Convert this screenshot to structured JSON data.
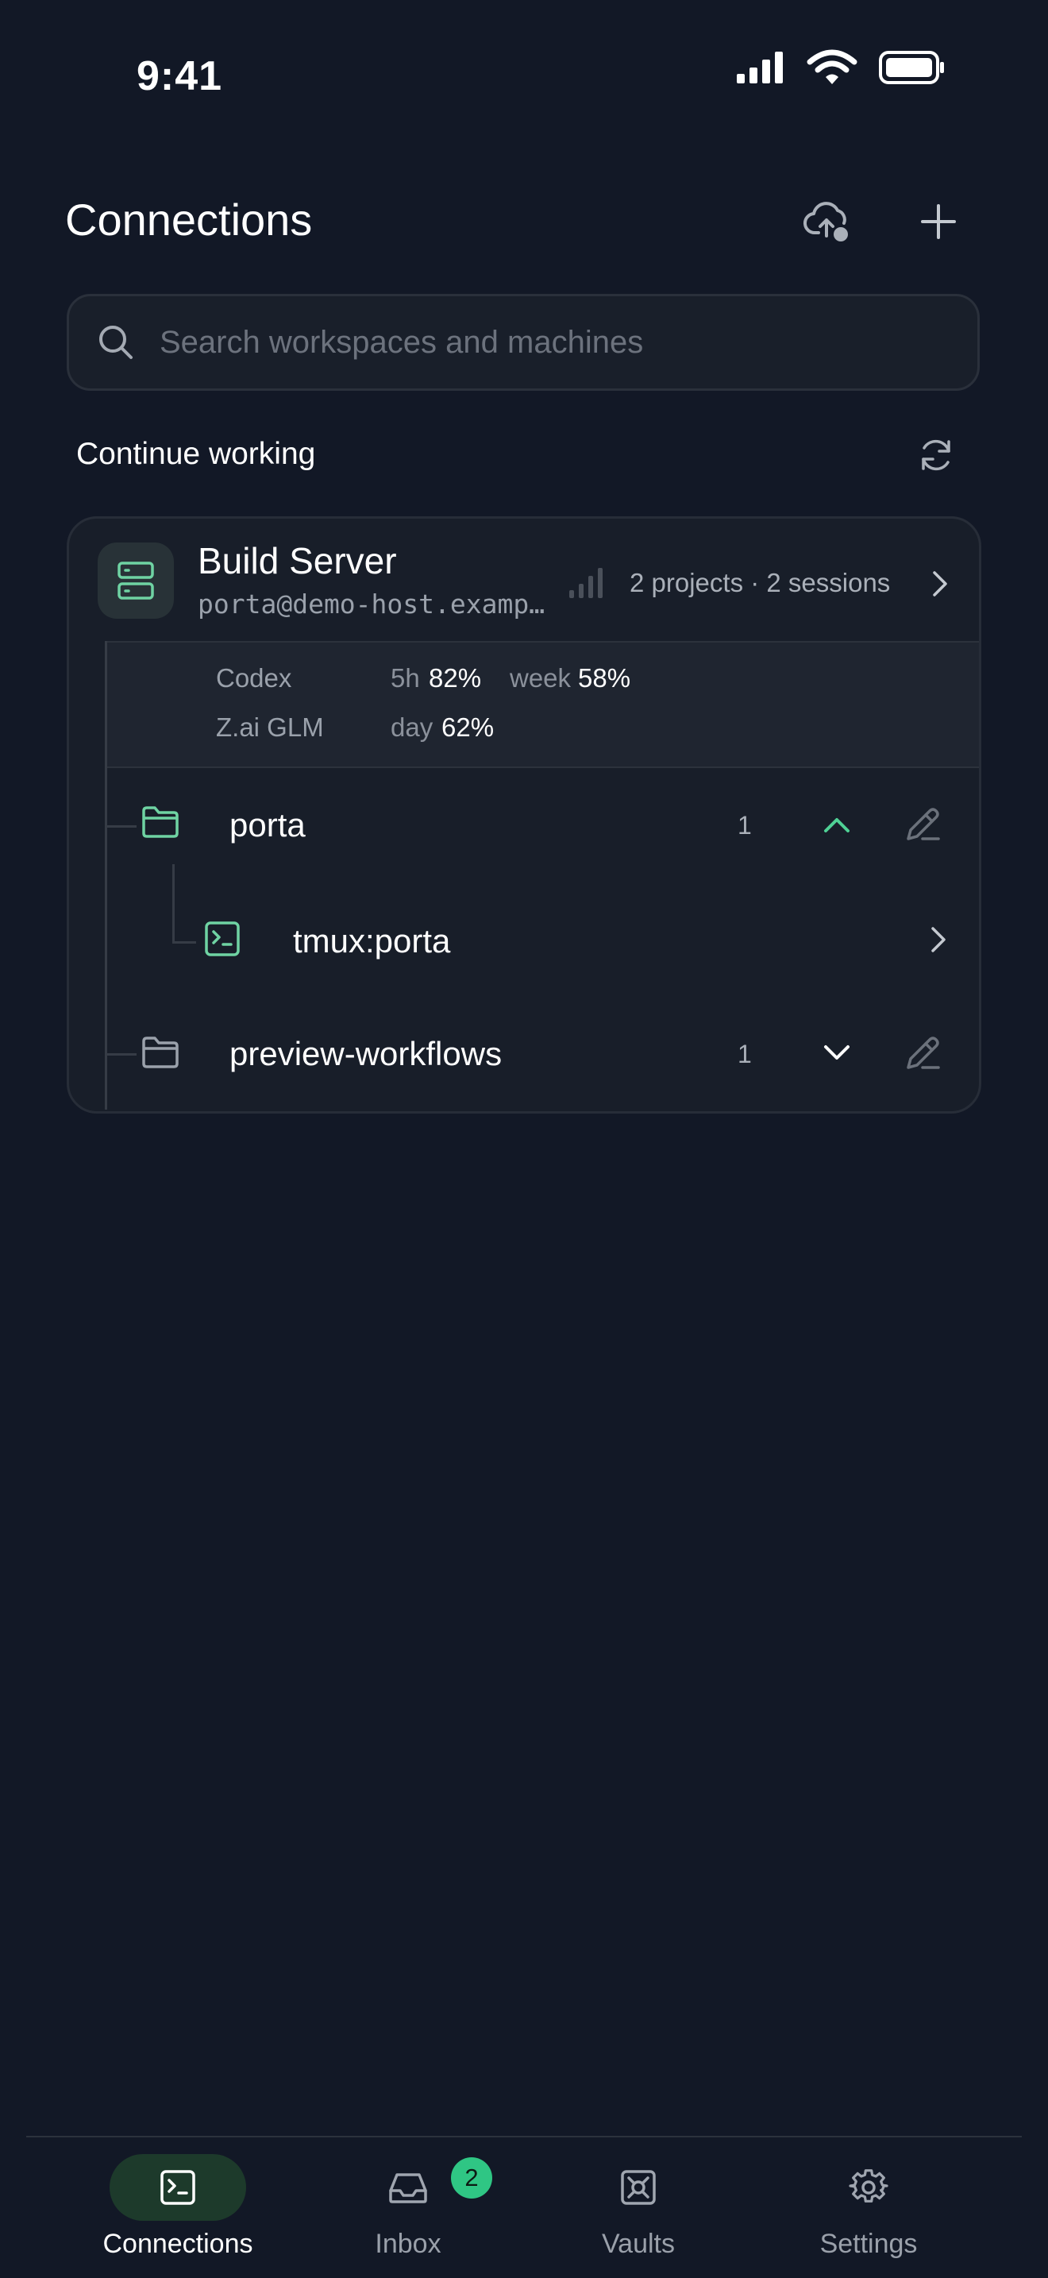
{
  "status_bar": {
    "time": "9:41",
    "icons": [
      "signal-icon",
      "wifi-icon",
      "battery-icon"
    ]
  },
  "header": {
    "title": "Connections",
    "actions": [
      {
        "icon": "cloud-sync-icon"
      },
      {
        "icon": "plus-icon"
      }
    ]
  },
  "search": {
    "placeholder": "Search workspaces and machines",
    "value": "",
    "icon": "search-icon"
  },
  "section": {
    "title": "Continue working",
    "action_icon": "refresh-icon"
  },
  "server": {
    "name": "Build Server",
    "host": "porta@demo-host.example.com",
    "meta": "2 projects · 2 sessions",
    "icon": "server-icon",
    "signal_icon": "signal-bars-icon",
    "usage": [
      {
        "provider": "Codex",
        "metrics": [
          {
            "label": "5h",
            "value": "82%"
          },
          {
            "label": "week",
            "value": "58%"
          }
        ]
      },
      {
        "provider": "Z.ai GLM",
        "metrics": [
          {
            "label": "day",
            "value": "62%"
          }
        ]
      }
    ],
    "projects": [
      {
        "name": "porta",
        "count": "1",
        "expanded": true,
        "sessions": [
          {
            "name": "tmux:porta",
            "icon": "terminal-icon"
          }
        ]
      },
      {
        "name": "preview-workflows",
        "count": "1",
        "expanded": false,
        "sessions": []
      }
    ]
  },
  "tabs": [
    {
      "label": "Connections",
      "icon": "terminal-icon",
      "active": true
    },
    {
      "label": "Inbox",
      "icon": "inbox-icon",
      "badge": "2"
    },
    {
      "label": "Vaults",
      "icon": "vault-icon"
    },
    {
      "label": "Settings",
      "icon": "gear-icon"
    }
  ],
  "colors": {
    "background": "#121826",
    "card": "#181e29",
    "accent": "#4fd195",
    "active_tab_pill": "#1d3a2b",
    "badge": "#2fc684"
  }
}
